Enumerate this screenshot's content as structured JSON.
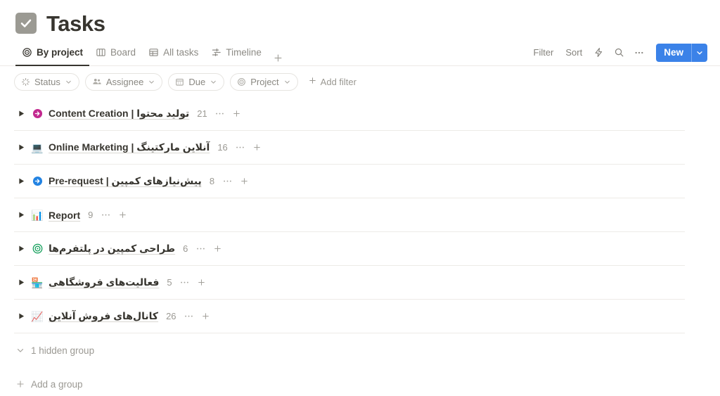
{
  "header": {
    "title": "Tasks",
    "icon": "checkbox-checked-icon",
    "icon_color": "#9b9a93"
  },
  "tabs": [
    {
      "label": "By project",
      "icon": "target-icon",
      "active": true
    },
    {
      "label": "Board",
      "icon": "board-columns-icon",
      "active": false
    },
    {
      "label": "All tasks",
      "icon": "table-icon",
      "active": false
    },
    {
      "label": "Timeline",
      "icon": "timeline-icon",
      "active": false
    }
  ],
  "tab_add": {
    "label": "+",
    "name": "add-view-button"
  },
  "toolbar": {
    "filter_label": "Filter",
    "sort_label": "Sort",
    "automation_icon": "lightning-bolt-icon",
    "search_icon": "search-icon",
    "more_icon": "ellipsis-icon",
    "new_label": "New",
    "new_caret_icon": "chevron-down-icon",
    "new_color": "#3b82e8"
  },
  "filters": {
    "chips": [
      {
        "label": "Status",
        "icon": "status-spinner-icon"
      },
      {
        "label": "Assignee",
        "icon": "people-icon"
      },
      {
        "label": "Due",
        "icon": "calendar-icon"
      },
      {
        "label": "Project",
        "icon": "target-icon"
      }
    ],
    "add_filter_label": "Add filter"
  },
  "groups": [
    {
      "name": "Content Creation | تولید محتوا",
      "count": "21",
      "icon": "arrow-circle-right-icon",
      "icon_kind": "svg-arrow",
      "icon_color": "#c2298f"
    },
    {
      "name": "Online Marketing | آنلاین مارکتینگ",
      "count": "16",
      "icon": "laptop-emoji",
      "icon_kind": "emoji",
      "emoji": "💻"
    },
    {
      "name": "Pre-request | پیش‌نیازهای کمپین",
      "count": "8",
      "icon": "arrow-circle-right-icon",
      "icon_kind": "svg-arrow",
      "icon_color": "#2383e2"
    },
    {
      "name": "Report",
      "count": "9",
      "icon": "bar-chart-emoji",
      "icon_kind": "emoji",
      "emoji": "📊"
    },
    {
      "name": "طراحی کمپین در پلتفرم‌ها",
      "count": "6",
      "icon": "bullseye-target-icon",
      "icon_kind": "svg-target",
      "icon_color": "#0f9d58"
    },
    {
      "name": "فعالیت‌های فروشگاهی",
      "count": "5",
      "icon": "convenience-store-emoji",
      "icon_kind": "emoji",
      "emoji": "🏪"
    },
    {
      "name": "کانال‌های فروش آنلاین",
      "count": "26",
      "icon": "chart-increasing-emoji",
      "icon_kind": "emoji",
      "emoji": "📈"
    }
  ],
  "group_row_more_icon": "ellipsis-icon",
  "group_row_add_icon": "plus-icon",
  "footer": {
    "hidden_group_label": "1 hidden group",
    "hidden_group_icon": "chevron-down-icon",
    "add_group_label": "Add a group",
    "add_group_icon": "plus-icon"
  }
}
